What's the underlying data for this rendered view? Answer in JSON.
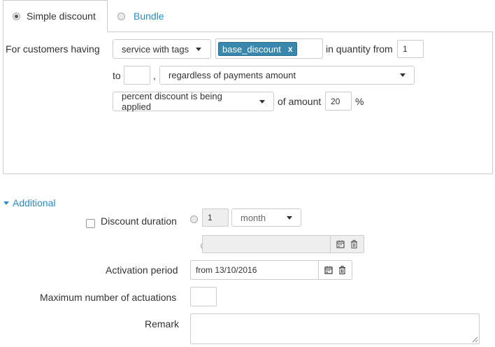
{
  "tabs": [
    {
      "label": "Simple discount",
      "selected": true
    },
    {
      "label": "Bundle",
      "selected": false
    }
  ],
  "condition": {
    "customers_label": "For customers having",
    "filter_select": "service with tags",
    "tag": "base_discount",
    "tag_remove": "x",
    "quantity_label": "in quantity from",
    "quantity_from": "1",
    "to_label": "to",
    "quantity_to": "",
    "comma": ",",
    "payments_select": "regardless of payments amount",
    "discount_type_select": "percent discount is being applied",
    "amount_label": "of amount",
    "amount_value": "20",
    "percent_sign": "%"
  },
  "additional": {
    "toggle_label": "Additional",
    "duration_label": "Discount duration",
    "duration_checked": false,
    "duration_number": "1",
    "duration_unit": "month",
    "duration_date": "",
    "activation_label": "Activation period",
    "activation_value": "from 13/10/2016",
    "max_actuations_label": "Maximum number of actuations",
    "max_actuations_value": "",
    "remark_label": "Remark",
    "remark_value": ""
  },
  "icons": {
    "calendar": "calendar-icon",
    "trash": "trash-icon",
    "caret": "caret-down-icon",
    "resize": "resize-handle-icon"
  },
  "colors": {
    "link": "#2a8bc4",
    "tag_bg": "#3a87ad",
    "border": "#cccccc",
    "disabled_bg": "#eeeeee"
  }
}
